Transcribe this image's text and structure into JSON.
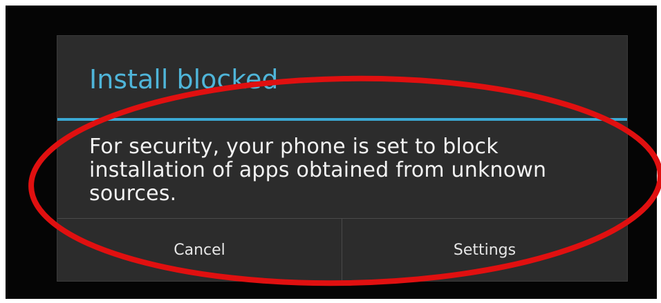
{
  "dialog": {
    "title": "Install blocked",
    "message": "For security, your phone is set to block installation of apps obtained from unknown sources.",
    "buttons": {
      "cancel_label": "Cancel",
      "settings_label": "Settings"
    }
  },
  "colors": {
    "title": "#4fb5d9",
    "title_divider": "#3ba9d4",
    "dialog_background": "#2c2c2c",
    "screen_background": "#050505",
    "annotation_ellipse": "#e01010"
  }
}
